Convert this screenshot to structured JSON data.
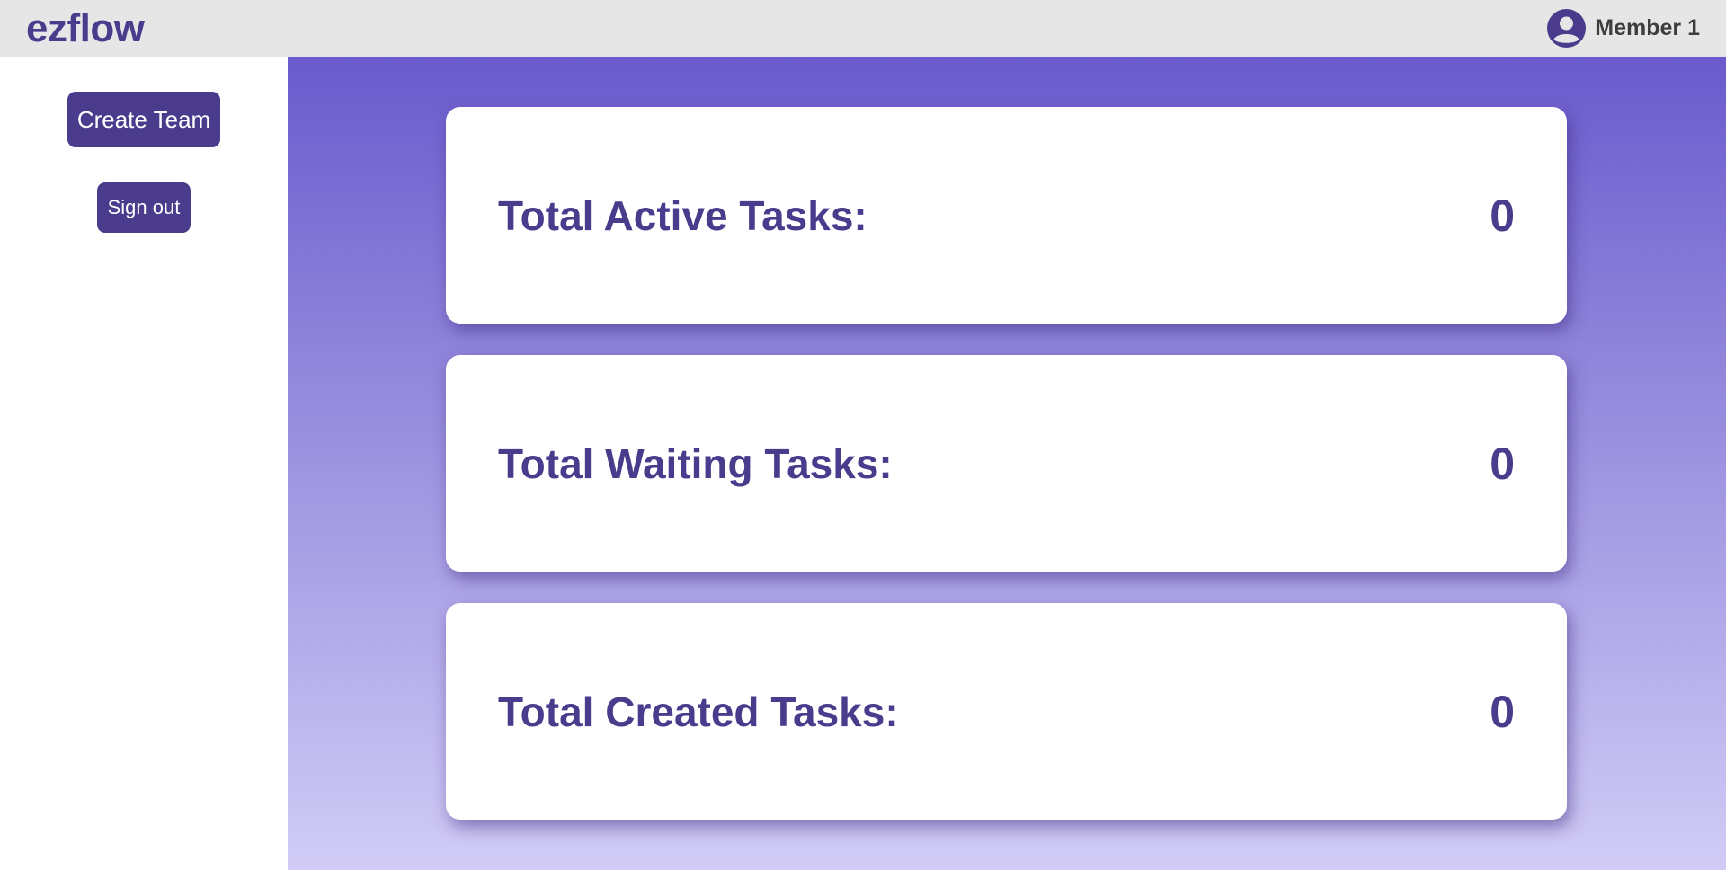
{
  "header": {
    "brand": "ezflow",
    "user_name": "Member 1",
    "user_icon": "user-circle-icon"
  },
  "sidebar": {
    "create_team_label": "Create Team",
    "sign_out_label": "Sign out"
  },
  "cards": [
    {
      "label": "Total Active Tasks:",
      "value": "0"
    },
    {
      "label": "Total Waiting Tasks:",
      "value": "0"
    },
    {
      "label": "Total Created Tasks:",
      "value": "0"
    }
  ],
  "colors": {
    "accent": "#4a3b8c",
    "header_bg": "#e6e6e6",
    "gradient_top": "#6a5acd",
    "gradient_bottom": "#d1ccf6"
  }
}
